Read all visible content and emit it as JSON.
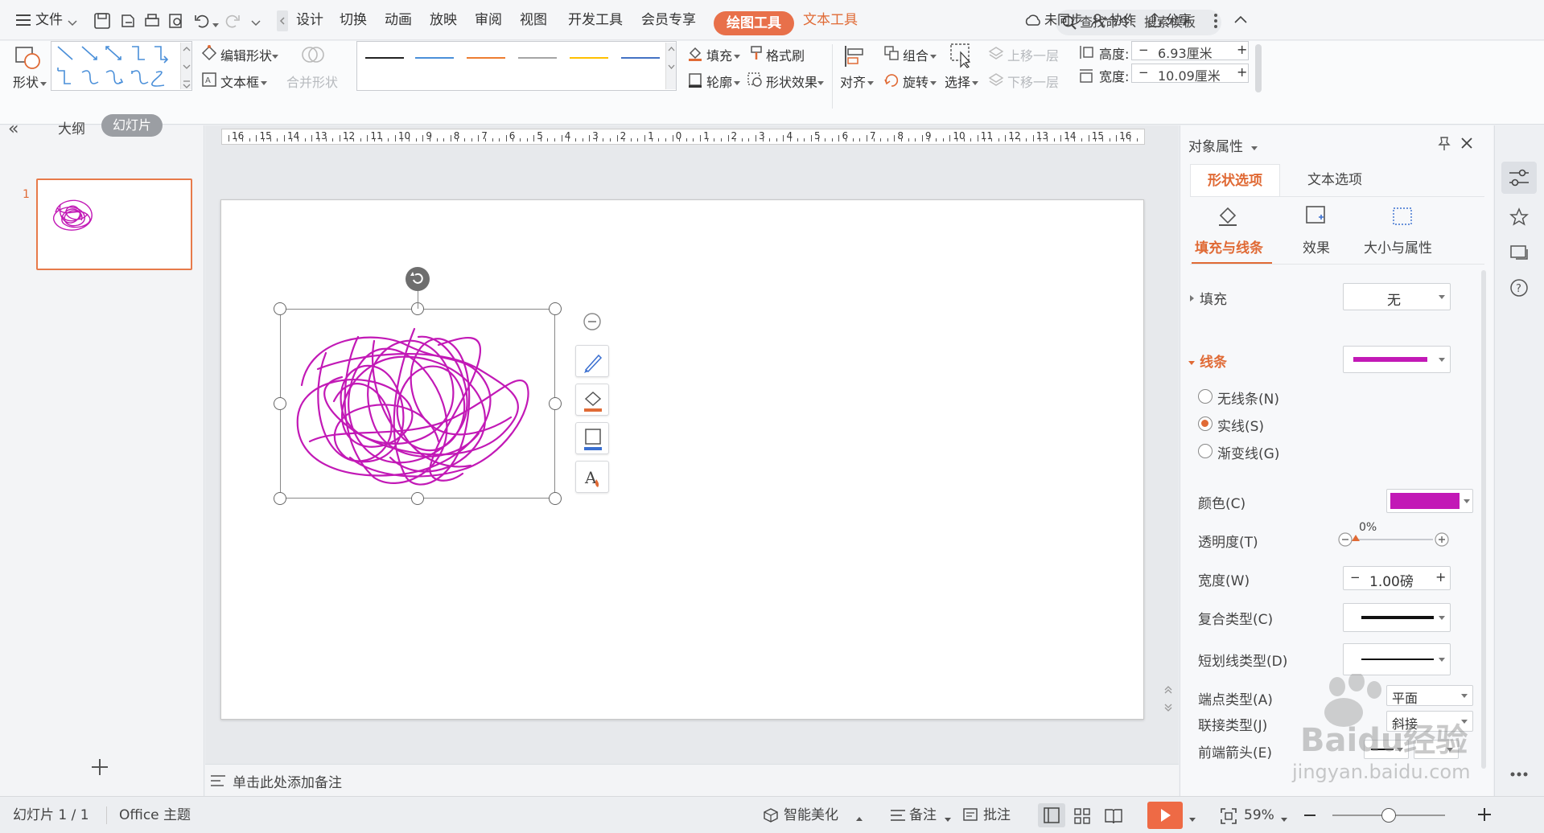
{
  "tabbar": {
    "menu_label": "文件",
    "tabs": [
      "设计",
      "切换",
      "动画",
      "放映",
      "审阅",
      "视图",
      "开发工具",
      "会员专享"
    ],
    "active_tool_tab": "绘图工具",
    "text_tool_tab": "文本工具",
    "search_placeholder": "查找命令、搜索模板",
    "sync": "未同步",
    "collab": "协作",
    "share": "分享"
  },
  "ribbon": {
    "shape_label": "形状",
    "edit_shape": "编辑形状",
    "textbox": "文本框",
    "merge_shape": "合并形状",
    "fill": "填充",
    "format_brush": "格式刷",
    "outline": "轮廓",
    "shape_effect": "形状效果",
    "align": "对齐",
    "group": "组合",
    "rotate": "旋转",
    "select": "选择",
    "bring_forward": "上移一层",
    "send_backward": "下移一层",
    "height_label": "高度:",
    "height_value": "6.93厘米",
    "width_label": "宽度:",
    "width_value": "10.09厘米",
    "line_colors": [
      "#222222",
      "#4a90d9",
      "#ed7d31",
      "#a5a5a5",
      "#ffc000",
      "#4472c4"
    ]
  },
  "leftpanel": {
    "outline_tab": "大纲",
    "slides_tab": "幻灯片",
    "slide_number": "1"
  },
  "ruler": {
    "ticks": [
      "16",
      "15",
      "14",
      "13",
      "12",
      "11",
      "10",
      "9",
      "8",
      "7",
      "6",
      "5",
      "4",
      "3",
      "2",
      "1",
      "0",
      "1",
      "2",
      "3",
      "4",
      "5",
      "6",
      "7",
      "8",
      "9",
      "10",
      "11",
      "12",
      "13",
      "14",
      "15",
      "16"
    ]
  },
  "notes": {
    "placeholder": "单击此处添加备注"
  },
  "rightpanel": {
    "title": "对象属性",
    "tabs": [
      "形状选项",
      "文本选项"
    ],
    "subtabs": [
      "填充与线条",
      "效果",
      "大小与属性"
    ],
    "fill_label": "填充",
    "fill_value": "无",
    "line_label": "线条",
    "line_color": "#c219b6",
    "radio_none": "无线条(N)",
    "radio_solid": "实线(S)",
    "radio_gradient": "渐变线(G)",
    "color_label": "颜色(C)",
    "transparency_label": "透明度(T)",
    "transparency_value": "0%",
    "transparency_level": 0,
    "width_label": "宽度(W)",
    "width_value": "1.00磅",
    "compound_label": "复合类型(C)",
    "dash_label": "短划线类型(D)",
    "cap_label": "端点类型(A)",
    "cap_value": "平面",
    "join_label": "联接类型(J)",
    "join_value": "斜接",
    "arrow_label": "前端箭头(E)"
  },
  "statusbar": {
    "slide_info": "幻灯片 1 / 1",
    "theme": "Office 主题",
    "smart_beautify": "智能美化",
    "notes": "备注",
    "comments": "批注",
    "zoom": "59%",
    "zoom_level": 0.5
  },
  "watermark": {
    "line1": "Baidu经验",
    "line2": "jingyan.baidu.com"
  },
  "colors": {
    "accent": "#e06a35",
    "scribble": "#c219b6"
  }
}
